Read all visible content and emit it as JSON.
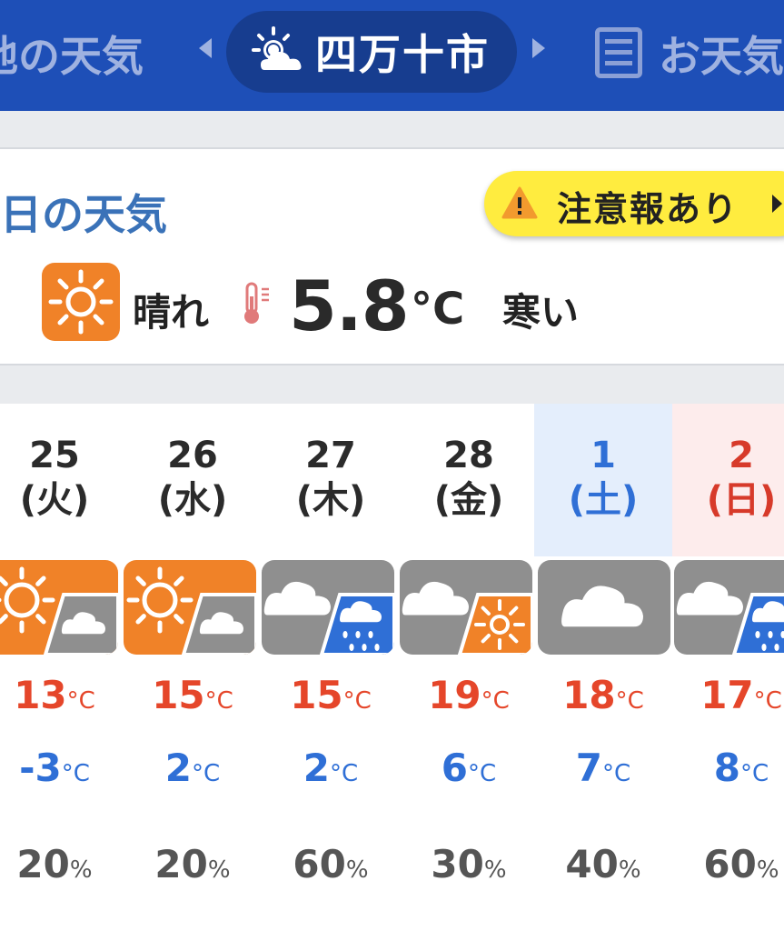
{
  "header": {
    "left_link": "地の天気",
    "city": "四万十市",
    "right_link": "お天気"
  },
  "today": {
    "title": "日の天気",
    "alert": "注意報あり",
    "weather": "晴れ",
    "temp": "5.8",
    "temp_unit": "°C",
    "feeling": "寒い"
  },
  "week": [
    {
      "day": "25",
      "weekday": "(火)",
      "icon": "sunny-then-cloudy",
      "high": "13",
      "low": "-3",
      "pop": "20"
    },
    {
      "day": "26",
      "weekday": "(水)",
      "icon": "sunny-then-cloudy",
      "high": "15",
      "low": "2",
      "pop": "20"
    },
    {
      "day": "27",
      "weekday": "(木)",
      "icon": "cloudy-then-rain",
      "high": "15",
      "low": "2",
      "pop": "60"
    },
    {
      "day": "28",
      "weekday": "(金)",
      "icon": "cloudy-then-sunny",
      "high": "19",
      "low": "6",
      "pop": "30"
    },
    {
      "day": "1",
      "weekday": "(土)",
      "icon": "cloudy",
      "high": "18",
      "low": "7",
      "pop": "40"
    },
    {
      "day": "2",
      "weekday": "(日)",
      "icon": "cloudy-then-rain",
      "high": "17",
      "low": "8",
      "pop": "60"
    }
  ],
  "units": {
    "temp": "°C",
    "pop": "%"
  },
  "colors": {
    "header_bg": "#1e4fb7",
    "sunny": "#f08228",
    "cloudy": "#8f8f8f",
    "rain": "#2f6fd6",
    "high_temp": "#e5462a",
    "low_temp": "#2f6fd6",
    "alert_bg": "#ffec3f"
  }
}
